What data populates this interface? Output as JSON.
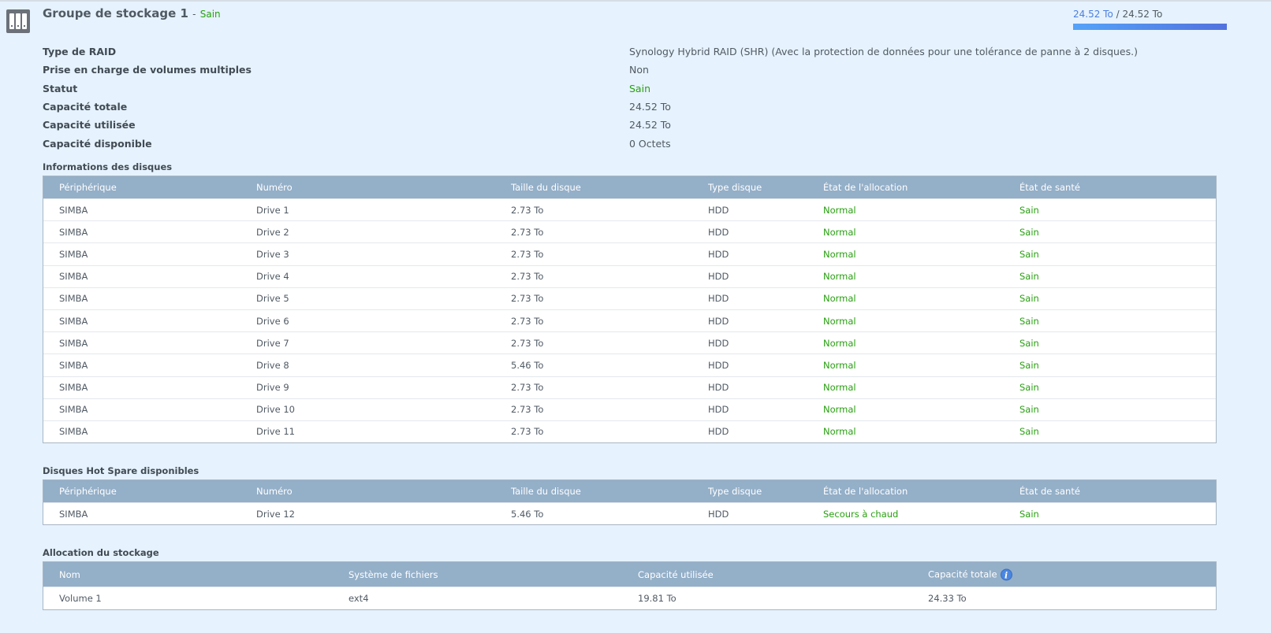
{
  "header": {
    "title": "Groupe de stockage 1",
    "separator": "-",
    "status": "Sain",
    "used": "24.52 To",
    "slash": " / ",
    "total": "24.52 To",
    "usage_percent": 100
  },
  "info": [
    {
      "label": "Type de RAID",
      "value": "Synology Hybrid RAID (SHR) (Avec la protection de données pour une tolérance de panne à 2 disques.)"
    },
    {
      "label": "Prise en charge de volumes multiples",
      "value": "Non"
    },
    {
      "label": "Statut",
      "value": "Sain",
      "status": true
    },
    {
      "label": "Capacité totale",
      "value": "24.52 To"
    },
    {
      "label": "Capacité utilisée",
      "value": "24.52 To"
    },
    {
      "label": "Capacité disponible",
      "value": "0 Octets"
    }
  ],
  "disks": {
    "title": "Informations des disques",
    "columns": [
      "Périphérique",
      "Numéro",
      "Taille du disque",
      "Type disque",
      "État de l'allocation",
      "État de santé"
    ],
    "rows": [
      [
        "SIMBA",
        "Drive 1",
        "2.73 To",
        "HDD",
        "Normal",
        "Sain"
      ],
      [
        "SIMBA",
        "Drive 2",
        "2.73 To",
        "HDD",
        "Normal",
        "Sain"
      ],
      [
        "SIMBA",
        "Drive 3",
        "2.73 To",
        "HDD",
        "Normal",
        "Sain"
      ],
      [
        "SIMBA",
        "Drive 4",
        "2.73 To",
        "HDD",
        "Normal",
        "Sain"
      ],
      [
        "SIMBA",
        "Drive 5",
        "2.73 To",
        "HDD",
        "Normal",
        "Sain"
      ],
      [
        "SIMBA",
        "Drive 6",
        "2.73 To",
        "HDD",
        "Normal",
        "Sain"
      ],
      [
        "SIMBA",
        "Drive 7",
        "2.73 To",
        "HDD",
        "Normal",
        "Sain"
      ],
      [
        "SIMBA",
        "Drive 8",
        "5.46 To",
        "HDD",
        "Normal",
        "Sain"
      ],
      [
        "SIMBA",
        "Drive 9",
        "2.73 To",
        "HDD",
        "Normal",
        "Sain"
      ],
      [
        "SIMBA",
        "Drive 10",
        "2.73 To",
        "HDD",
        "Normal",
        "Sain"
      ],
      [
        "SIMBA",
        "Drive 11",
        "2.73 To",
        "HDD",
        "Normal",
        "Sain"
      ]
    ]
  },
  "hotspare": {
    "title": "Disques Hot Spare disponibles",
    "columns": [
      "Périphérique",
      "Numéro",
      "Taille du disque",
      "Type disque",
      "État de l'allocation",
      "État de santé"
    ],
    "rows": [
      [
        "SIMBA",
        "Drive 12",
        "5.46 To",
        "HDD",
        "Secours à chaud",
        "Sain"
      ]
    ]
  },
  "allocation": {
    "title": "Allocation du stockage",
    "columns": [
      "Nom",
      "Système de fichiers",
      "Capacité utilisée",
      "Capacité totale"
    ],
    "info_icon": "i",
    "rows": [
      [
        "Volume 1",
        "ext4",
        "19.81 To",
        "24.33 To"
      ]
    ]
  },
  "colors": {
    "ok": "#28a010",
    "header": "#94afc8",
    "accent": "#4b7fe0"
  }
}
